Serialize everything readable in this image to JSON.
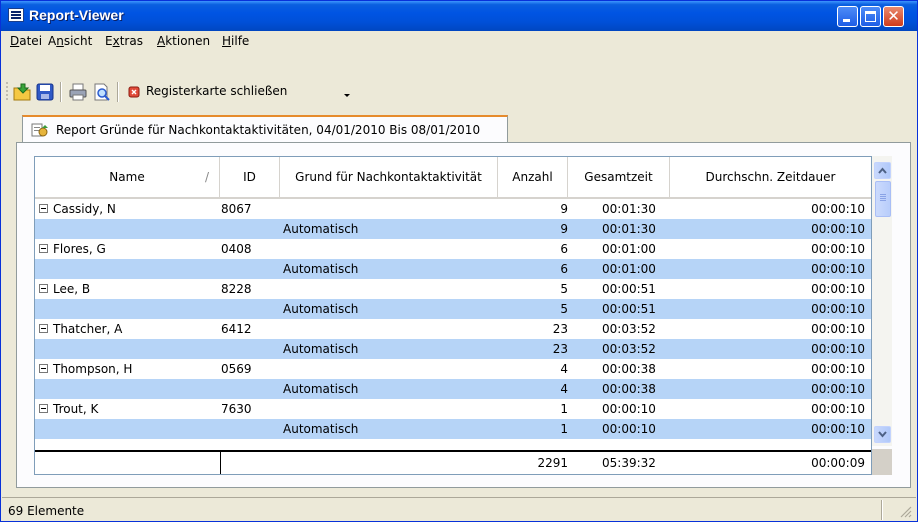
{
  "window": {
    "title": "Report-Viewer"
  },
  "menu": [
    "Datei",
    "Ansicht",
    "Extras",
    "Aktionen",
    "Hilfe"
  ],
  "menu_mnemonics": [
    "D",
    "n",
    "x",
    "A",
    "H"
  ],
  "toolbar": {
    "close_tab_label": "Registerkarte schließen"
  },
  "tab": {
    "label": "Report Gründe für Nachkontaktaktivitäten, 04/01/2010 Bis 08/01/2010"
  },
  "columns": [
    "Name",
    "ID",
    "Grund für Nachkontaktaktivität",
    "Anzahl",
    "Gesamtzeit",
    "Durchschn. Zeitdauer"
  ],
  "sort_indicator": "/",
  "rows": [
    {
      "type": "group",
      "name": "Cassidy, N",
      "id": "8067",
      "reason": "",
      "count": "9",
      "total": "00:01:30",
      "avg": "00:00:10"
    },
    {
      "type": "detail",
      "name": "",
      "id": "",
      "reason": "Automatisch",
      "count": "9",
      "total": "00:01:30",
      "avg": "00:00:10"
    },
    {
      "type": "group",
      "name": "Flores, G",
      "id": "0408",
      "reason": "",
      "count": "6",
      "total": "00:01:00",
      "avg": "00:00:10"
    },
    {
      "type": "detail",
      "name": "",
      "id": "",
      "reason": "Automatisch",
      "count": "6",
      "total": "00:01:00",
      "avg": "00:00:10"
    },
    {
      "type": "group",
      "name": "Lee, B",
      "id": "8228",
      "reason": "",
      "count": "5",
      "total": "00:00:51",
      "avg": "00:00:10"
    },
    {
      "type": "detail",
      "name": "",
      "id": "",
      "reason": "Automatisch",
      "count": "5",
      "total": "00:00:51",
      "avg": "00:00:10"
    },
    {
      "type": "group",
      "name": "Thatcher, A",
      "id": "6412",
      "reason": "",
      "count": "23",
      "total": "00:03:52",
      "avg": "00:00:10"
    },
    {
      "type": "detail",
      "name": "",
      "id": "",
      "reason": "Automatisch",
      "count": "23",
      "total": "00:03:52",
      "avg": "00:00:10"
    },
    {
      "type": "group",
      "name": "Thompson, H",
      "id": "0569",
      "reason": "",
      "count": "4",
      "total": "00:00:38",
      "avg": "00:00:10"
    },
    {
      "type": "detail",
      "name": "",
      "id": "",
      "reason": "Automatisch",
      "count": "4",
      "total": "00:00:38",
      "avg": "00:00:10"
    },
    {
      "type": "group",
      "name": "Trout, K",
      "id": "7630",
      "reason": "",
      "count": "1",
      "total": "00:00:10",
      "avg": "00:00:10"
    },
    {
      "type": "detail",
      "name": "",
      "id": "",
      "reason": "Automatisch",
      "count": "1",
      "total": "00:00:10",
      "avg": "00:00:10"
    }
  ],
  "totals": {
    "count": "2291",
    "total": "05:39:32",
    "avg": "00:00:09"
  },
  "status": {
    "text": "69 Elemente"
  }
}
